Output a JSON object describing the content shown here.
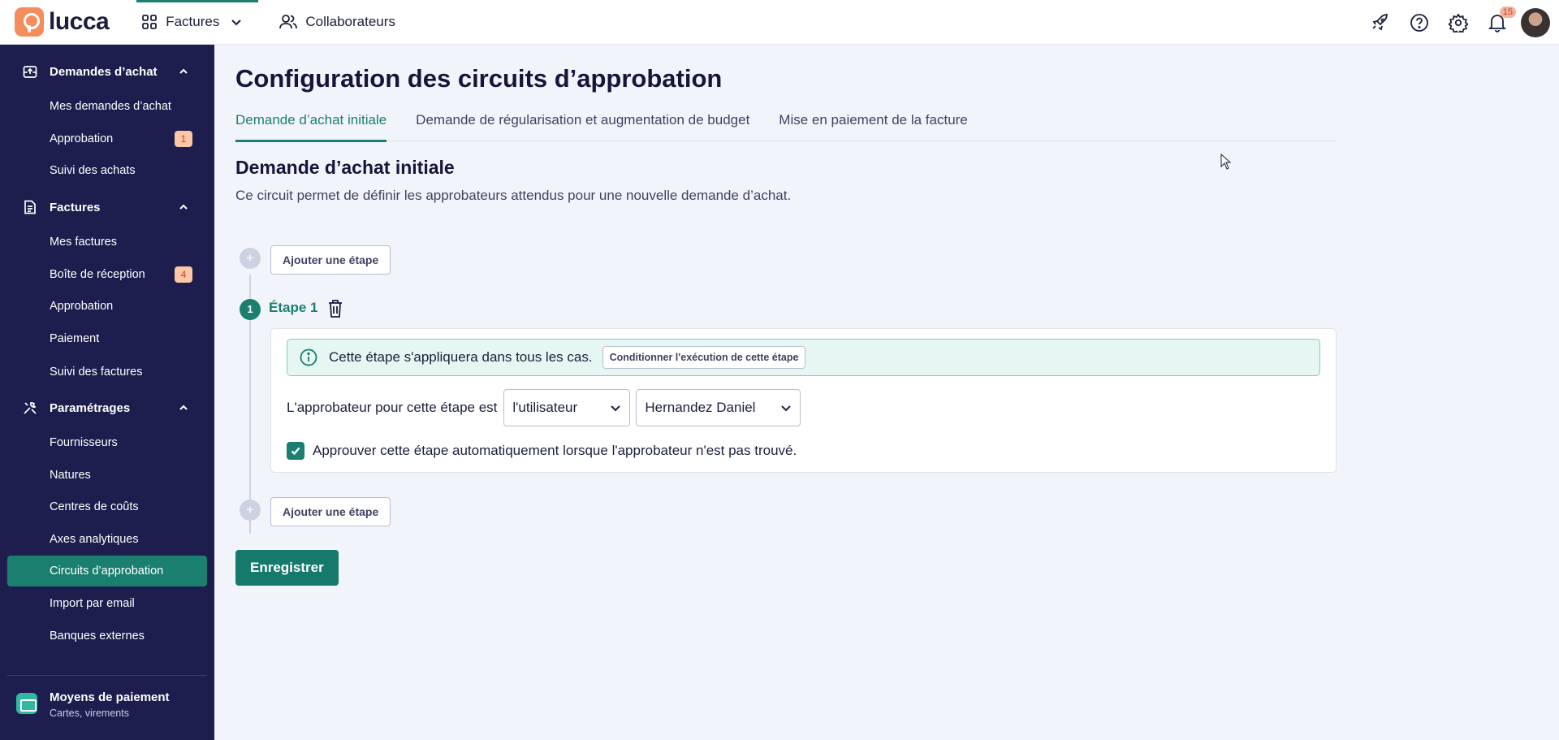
{
  "app": {
    "logo_text": "lucca"
  },
  "topnav": {
    "items": [
      {
        "label": "Factures",
        "icon": "apps-grid-icon",
        "active": true
      },
      {
        "label": "Collaborateurs",
        "icon": "users-icon",
        "active": false
      }
    ],
    "right_icons": [
      "rocket-icon",
      "help-icon",
      "gear-icon",
      "bell-icon"
    ],
    "notification_count": "15"
  },
  "sidebar": {
    "sections": [
      {
        "title": "Demandes d’achat",
        "icon": "inbox-upload-icon",
        "items": [
          {
            "label": "Mes demandes d’achat"
          },
          {
            "label": "Approbation",
            "badge": "1"
          },
          {
            "label": "Suivi des achats"
          }
        ]
      },
      {
        "title": "Factures",
        "icon": "document-icon",
        "items": [
          {
            "label": "Mes factures"
          },
          {
            "label": "Boîte de réception",
            "badge": "4"
          },
          {
            "label": "Approbation"
          },
          {
            "label": "Paiement"
          },
          {
            "label": "Suivi des factures"
          }
        ]
      },
      {
        "title": "Paramétrages",
        "icon": "tools-icon",
        "items": [
          {
            "label": "Fournisseurs"
          },
          {
            "label": "Natures"
          },
          {
            "label": "Centres de coûts"
          },
          {
            "label": "Axes analytiques"
          },
          {
            "label": "Circuits d’approbation",
            "active": true
          },
          {
            "label": "Import par email"
          },
          {
            "label": "Banques externes"
          }
        ]
      }
    ],
    "footer": {
      "title": "Moyens de paiement",
      "subtitle": "Cartes, virements"
    }
  },
  "main": {
    "page_title": "Configuration des circuits d’approbation",
    "tabs": [
      {
        "label": "Demande d’achat initiale",
        "active": true
      },
      {
        "label": "Demande de régularisation et augmentation de budget",
        "active": false
      },
      {
        "label": "Mise en paiement de la facture",
        "active": false
      }
    ],
    "section_title": "Demande d’achat initiale",
    "section_description": "Ce circuit permet de définir les approbateurs attendus pour une nouvelle demande d’achat.",
    "add_step_label": "Ajouter une étape",
    "step": {
      "number": "1",
      "label": "Étape 1",
      "info_text": "Cette étape s'appliquera dans tous les cas.",
      "condition_button": "Conditionner l'exécution de cette étape",
      "approver_label": "L'approbateur pour cette étape est",
      "approver_type": "l'utilisateur",
      "approver_user": "Hernandez Daniel",
      "auto_approve_label": "Approuver cette étape automatiquement lorsque l'approbateur n'est pas trouvé.",
      "auto_approve_checked": true
    },
    "save_label": "Enregistrer"
  },
  "colors": {
    "accent": "#1a7f6f",
    "sidebar_bg": "#1d1e4e",
    "badge_bg": "#fbc7a4",
    "logo": "#f48c5c"
  }
}
